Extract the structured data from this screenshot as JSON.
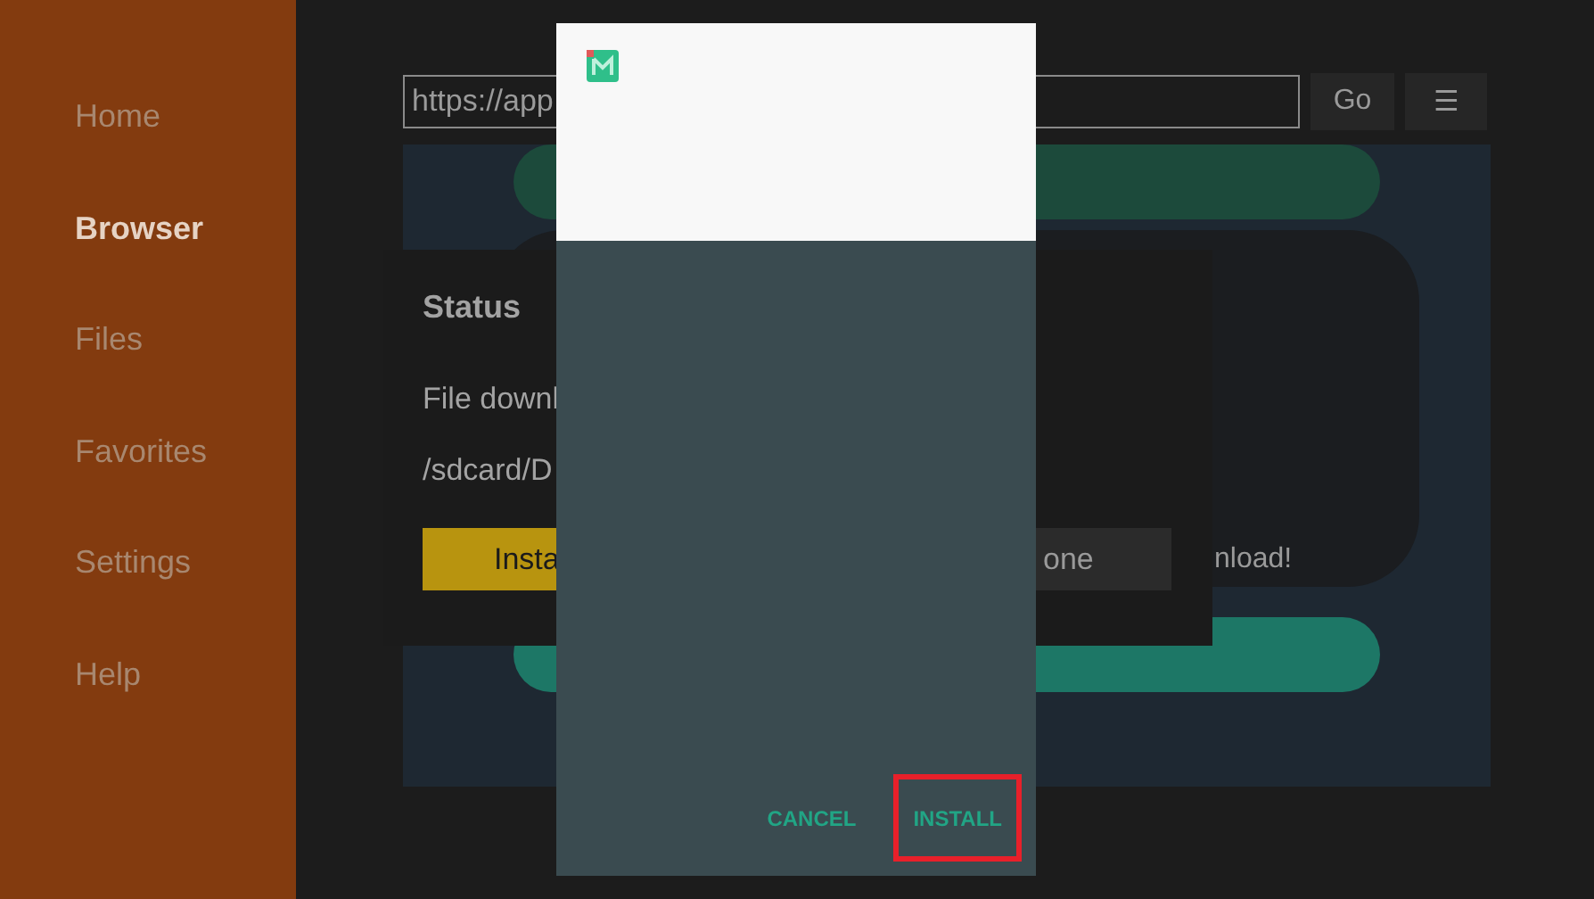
{
  "sidebar": {
    "items": [
      {
        "label": "Home",
        "selected": false
      },
      {
        "label": "Browser",
        "selected": true
      },
      {
        "label": "Files",
        "selected": false
      },
      {
        "label": "Favorites",
        "selected": false
      },
      {
        "label": "Settings",
        "selected": false
      },
      {
        "label": "Help",
        "selected": false
      }
    ]
  },
  "url_bar": {
    "value": "https://app"
  },
  "go_button": "Go",
  "menu_button": "☰",
  "page": {
    "text": "nload!"
  },
  "status_dialog": {
    "title": "Status",
    "lines": [
      "File downl",
      "/sdcard/D"
    ],
    "buttons": [
      {
        "label": "Insta",
        "kind": "primary"
      },
      {
        "label": "one",
        "kind": "secondary"
      }
    ]
  },
  "install_dialog": {
    "buttons": [
      {
        "label": "CANCEL",
        "highlighted": false
      },
      {
        "label": "INSTALL",
        "highlighted": true
      }
    ]
  }
}
